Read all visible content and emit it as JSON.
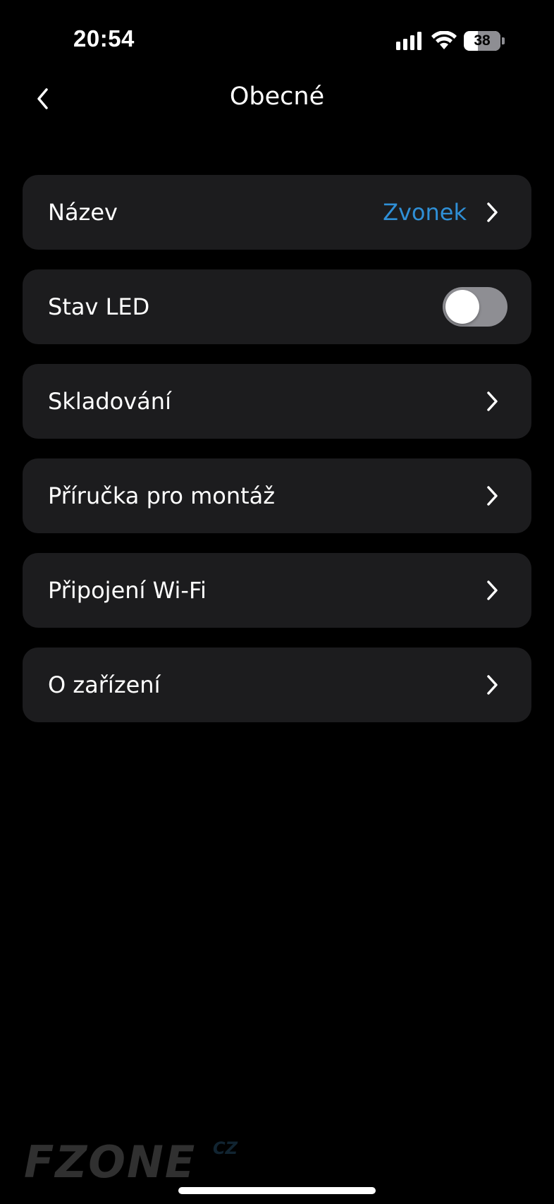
{
  "status_bar": {
    "time": "20:54",
    "battery_level": "38",
    "icons": [
      "cellular-signal-icon",
      "wifi-icon",
      "battery-icon"
    ]
  },
  "header": {
    "title": "Obecné",
    "back_icon": "chevron-left-icon"
  },
  "settings": {
    "name": {
      "label": "Název",
      "value": "Zvonek"
    },
    "led": {
      "label": "Stav LED",
      "enabled": false
    },
    "storage": {
      "label": "Skladování"
    },
    "install_guide": {
      "label": "Příručka pro montáž"
    },
    "wifi": {
      "label": "Připojení Wi-Fi"
    },
    "about": {
      "label": "O zařízení"
    }
  },
  "watermark": {
    "text": "FZONE",
    "superscript": "CZ"
  },
  "colors": {
    "background": "#000000",
    "row_background": "#1c1c1e",
    "accent": "#2f8fd6",
    "toggle_off": "#8e8e93"
  }
}
